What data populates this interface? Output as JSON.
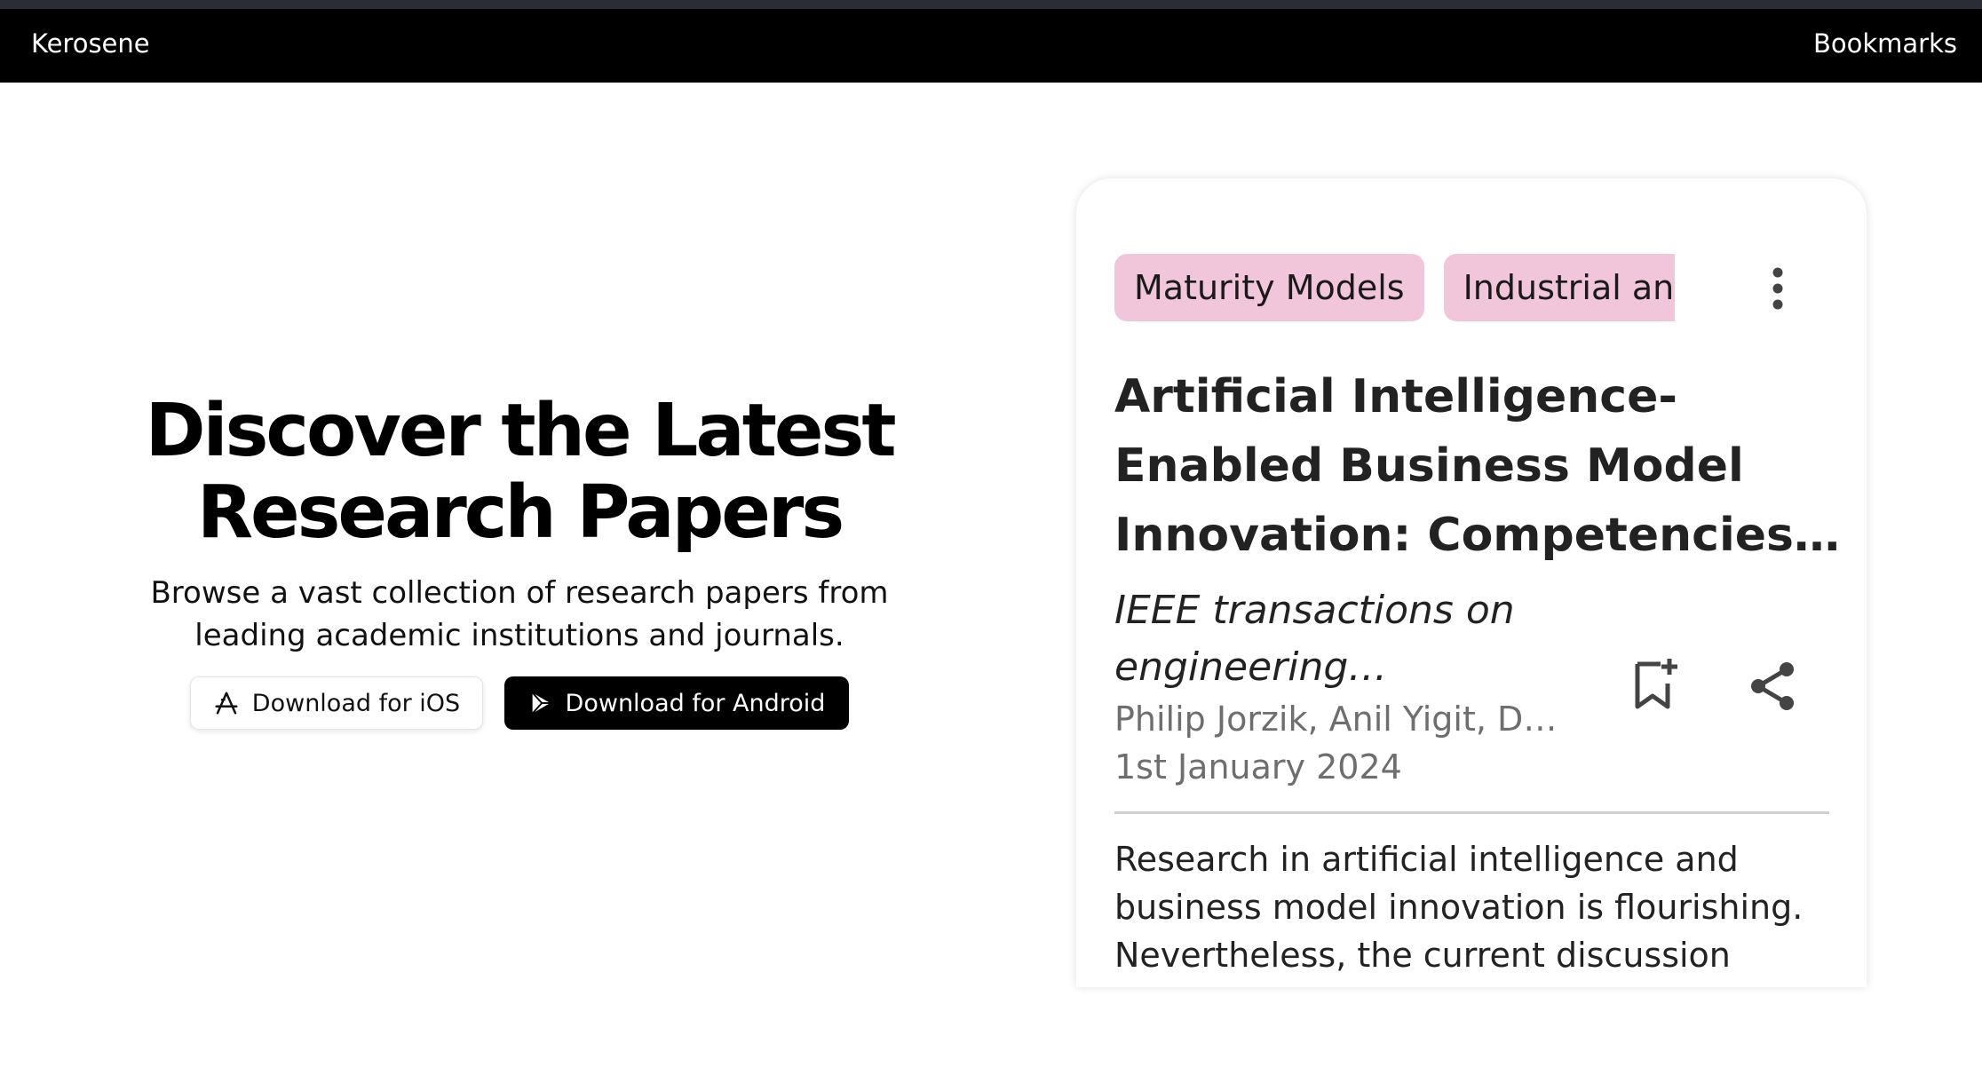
{
  "nav": {
    "brand": "Kerosene",
    "bookmarks": "Bookmarks"
  },
  "hero": {
    "title_line1": "Discover the Latest",
    "title_line2": "Research Papers",
    "subtitle": "Browse a vast collection of research papers from leading academic institutions and journals.",
    "ios_button": "Download for iOS",
    "android_button": "Download for Android"
  },
  "card": {
    "chips": [
      "Maturity Models",
      "Industrial and"
    ],
    "title": "Artificial Intelligence-Enabled Business Model Innovation: Competencies and Roles of Top Management",
    "journal": "IEEE transactions on engineering management",
    "authors": "Philip Jorzik, Anil Yigit, Dominik K. Kanbach",
    "date": "1st January 2024",
    "abstract": "Research in artificial intelligence and business model innovation is flourishing. Nevertheless, the current discussion",
    "icons": {
      "more": "more-vertical-icon",
      "bookmark": "bookmark-add-icon",
      "share": "share-icon"
    }
  },
  "colors": {
    "navbar": "#000000",
    "chip": "#f1c6da",
    "android_button": "#000000",
    "muted_text": "#6e6e6e"
  }
}
